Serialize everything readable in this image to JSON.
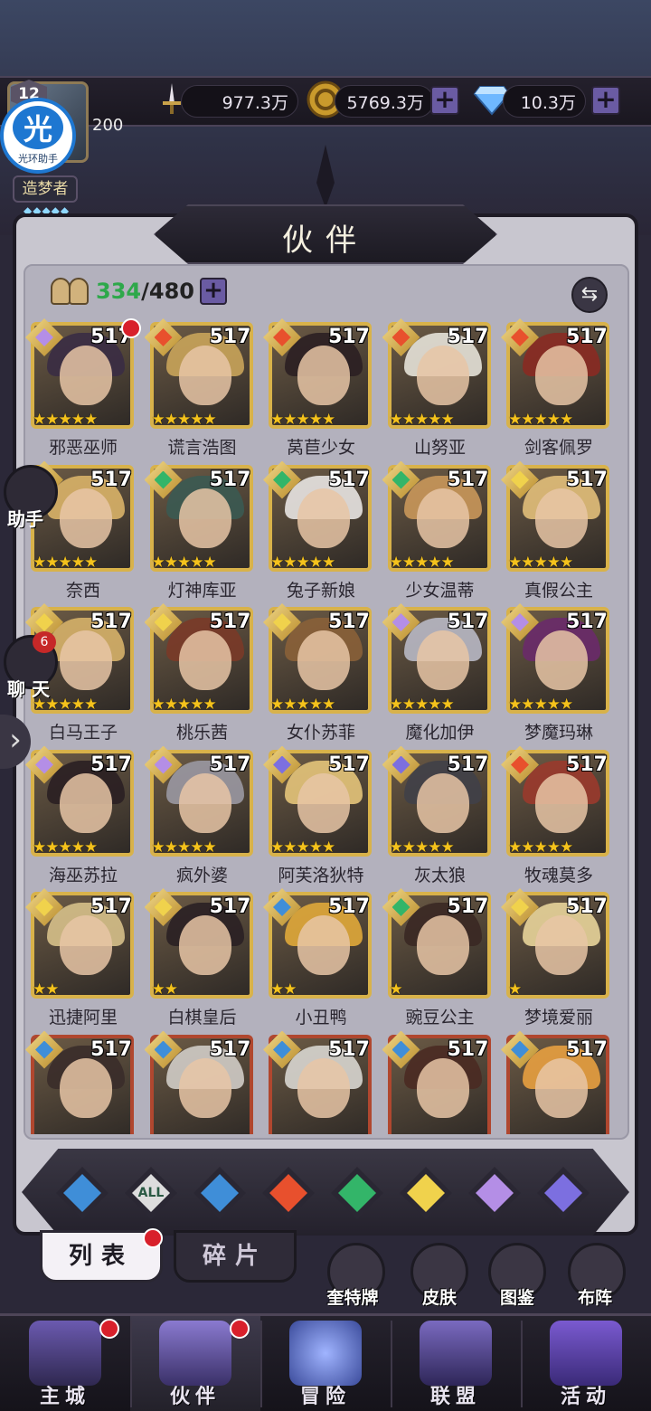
{
  "colors": {
    "accent": "#6a5ba3",
    "gold": "#d8b24a",
    "red_dot": "#d8202b",
    "green_count": "#2ea84a"
  },
  "header": {
    "level": "12",
    "power": "200",
    "helper_big": "光",
    "helper_small": "光环助手",
    "rank": "造梦者",
    "rank_stars": "◆◆◆◆◆",
    "resources": [
      {
        "icon": "sword-icon",
        "value": "977.3万"
      },
      {
        "icon": "gold-coin-icon",
        "value": "5769.3万"
      },
      {
        "icon": "diamond-icon",
        "value": "10.3万"
      }
    ],
    "plus": "+"
  },
  "panel": {
    "title": "伙伴",
    "count_current": "334",
    "count_total": "/480",
    "plus": "+",
    "swap_icon": "⇆"
  },
  "side": {
    "assistant": "助手",
    "chat": "聊 天",
    "chat_badge": "6",
    "expand": "›"
  },
  "elements": {
    "dark": "#b48ee6",
    "fire": "#e8502d",
    "wind": "#33b569",
    "light": "#f0d24c",
    "water": "#3f8ed8",
    "cosmic": "#7c6fe0"
  },
  "characters": [
    {
      "name": "邪恶巫师",
      "level": "517",
      "element": "dark",
      "hair": "#3a2c44",
      "stars": "★★★★★",
      "dot": true
    },
    {
      "name": "谎言浩图",
      "level": "517",
      "element": "fire",
      "hair": "#c9a45a",
      "stars": "★★★★★",
      "dot": false
    },
    {
      "name": "莴苣少女",
      "level": "517",
      "element": "fire",
      "hair": "#2b1f22",
      "stars": "★★★★★",
      "dot": false
    },
    {
      "name": "山努亚",
      "level": "517",
      "element": "fire",
      "hair": "#e6e2d8",
      "stars": "★★★★★",
      "dot": false
    },
    {
      "name": "剑客佩罗",
      "level": "517",
      "element": "fire",
      "hair": "#8a2a22",
      "stars": "★★★★★",
      "dot": false
    },
    {
      "name": "奈西",
      "level": "517",
      "element": "light",
      "hair": "#d9b368",
      "stars": "★★★★★",
      "dot": false
    },
    {
      "name": "灯神库亚",
      "level": "517",
      "element": "wind",
      "hair": "#3b5a52",
      "stars": "★★★★★",
      "dot": false
    },
    {
      "name": "兔子新娘",
      "level": "517",
      "element": "wind",
      "hair": "#e8e4e2",
      "stars": "★★★★★",
      "dot": false
    },
    {
      "name": "少女温蒂",
      "level": "517",
      "element": "wind",
      "hair": "#c9975a",
      "stars": "★★★★★",
      "dot": false
    },
    {
      "name": "真假公主",
      "level": "517",
      "element": "light",
      "hair": "#e2bf7a",
      "stars": "★★★★★",
      "dot": false
    },
    {
      "name": "白马王子",
      "level": "517",
      "element": "light",
      "hair": "#d6b169",
      "stars": "★★★★★",
      "dot": false
    },
    {
      "name": "桃乐茜",
      "level": "517",
      "element": "light",
      "hair": "#7a3a28",
      "stars": "★★★★★",
      "dot": false
    },
    {
      "name": "女仆苏菲",
      "level": "517",
      "element": "light",
      "hair": "#8a6038",
      "stars": "★★★★★",
      "dot": false
    },
    {
      "name": "魔化加伊",
      "level": "517",
      "element": "dark",
      "hair": "#b8b8c4",
      "stars": "★★★★★",
      "dot": false
    },
    {
      "name": "梦魔玛琳",
      "level": "517",
      "element": "dark",
      "hair": "#6a2a6a",
      "stars": "★★★★★",
      "dot": false
    },
    {
      "name": "海巫苏拉",
      "level": "517",
      "element": "dark",
      "hair": "#2a1f22",
      "stars": "★★★★★",
      "dot": false
    },
    {
      "name": "疯外婆",
      "level": "517",
      "element": "dark",
      "hair": "#9a98a2",
      "stars": "★★★★★",
      "dot": false
    },
    {
      "name": "阿芙洛狄特",
      "level": "517",
      "element": "cosmic",
      "hair": "#e4c47a",
      "stars": "★★★★★",
      "dot": false
    },
    {
      "name": "灰太狼",
      "level": "517",
      "element": "cosmic",
      "hair": "#404048",
      "stars": "★★★★★",
      "dot": false
    },
    {
      "name": "牧魂莫多",
      "level": "517",
      "element": "fire",
      "hair": "#9a3a2c",
      "stars": "★★★★★",
      "dot": false
    },
    {
      "name": "迅捷阿里",
      "level": "517",
      "element": "light",
      "hair": "#d6c08a",
      "stars": "★★",
      "dot": false
    },
    {
      "name": "白棋皇后",
      "level": "517",
      "element": "light",
      "hair": "#2a2024",
      "stars": "★★",
      "dot": false
    },
    {
      "name": "小丑鸭",
      "level": "517",
      "element": "water",
      "hair": "#e0a83a",
      "stars": "★★",
      "dot": false
    },
    {
      "name": "豌豆公主",
      "level": "517",
      "element": "wind",
      "hair": "#3a2824",
      "stars": "★",
      "dot": false
    },
    {
      "name": "梦境爱丽",
      "level": "517",
      "element": "light",
      "hair": "#e8d49a",
      "stars": "★",
      "dot": false
    },
    {
      "name": "",
      "level": "517",
      "element": "water",
      "hair": "#3a2c2a",
      "stars": "",
      "dot": false
    },
    {
      "name": "",
      "level": "517",
      "element": "water",
      "hair": "#d0ccc6",
      "stars": "",
      "dot": false
    },
    {
      "name": "",
      "level": "517",
      "element": "water",
      "hair": "#d8d6d0",
      "stars": "",
      "dot": false
    },
    {
      "name": "",
      "level": "517",
      "element": "water",
      "hair": "#4a2a22",
      "stars": "",
      "dot": false
    },
    {
      "name": "",
      "level": "517",
      "element": "water",
      "hair": "#e8a040",
      "stars": "",
      "dot": false
    }
  ],
  "filters": [
    {
      "id": "outline",
      "color": "#3f8ed8"
    },
    {
      "id": "all",
      "label": "ALL",
      "color": "#dddddd"
    },
    {
      "id": "water",
      "color": "#3f8ed8"
    },
    {
      "id": "fire",
      "color": "#e8502d"
    },
    {
      "id": "wind",
      "color": "#33b569"
    },
    {
      "id": "light",
      "color": "#f0d24c"
    },
    {
      "id": "dark",
      "color": "#b48ee6"
    },
    {
      "id": "cosmic",
      "color": "#7c6fe0"
    }
  ],
  "tabs": {
    "list": "列表",
    "fragments": "碎片"
  },
  "quick": [
    {
      "label": "奎特牌",
      "icon": "card-deck-icon"
    },
    {
      "label": "皮肤",
      "icon": "costume-icon"
    },
    {
      "label": "图鉴",
      "icon": "codex-icon"
    },
    {
      "label": "布阵",
      "icon": "formation-icon"
    }
  ],
  "nav": [
    {
      "label": "主城",
      "icon": "castle-icon",
      "dot": true
    },
    {
      "label": "伙伴",
      "icon": "witch-hat-icon",
      "dot": true
    },
    {
      "label": "冒险",
      "icon": "compass-icon",
      "dot": false
    },
    {
      "label": "联盟",
      "icon": "shield-icon",
      "dot": false
    },
    {
      "label": "活动",
      "icon": "cards-icon",
      "dot": false
    }
  ]
}
